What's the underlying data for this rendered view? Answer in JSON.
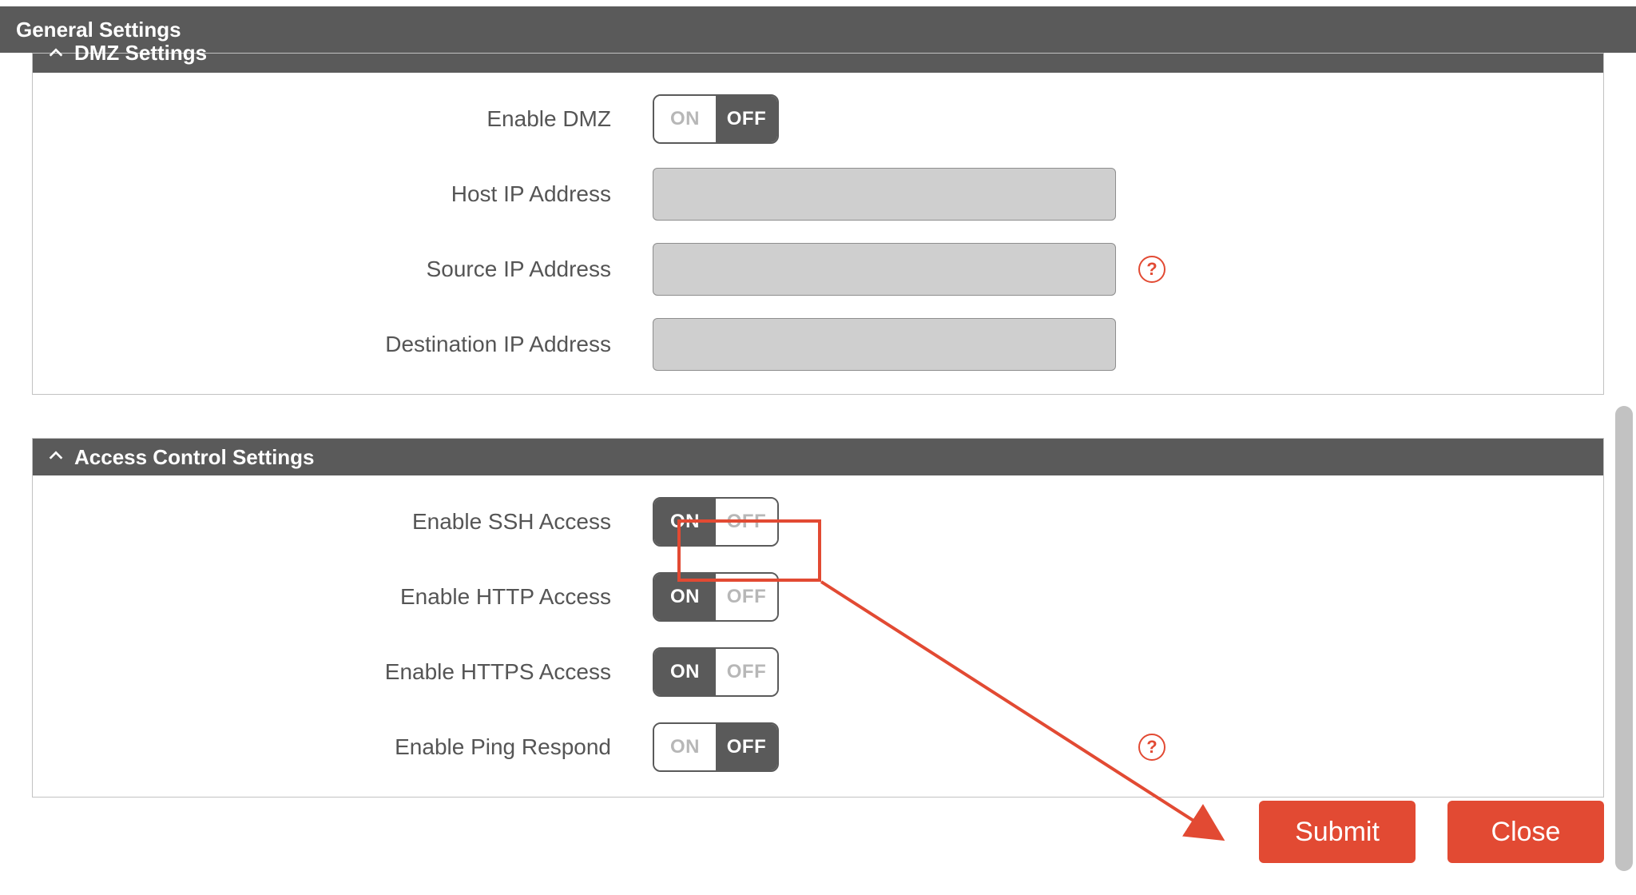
{
  "page_title": "General Settings",
  "toggle": {
    "on": "ON",
    "off": "OFF"
  },
  "help_glyph": "?",
  "sections": {
    "dmz": {
      "title": "DMZ Settings",
      "rows": {
        "enable": {
          "label": "Enable DMZ",
          "state": "off"
        },
        "host_ip": {
          "label": "Host IP Address",
          "value": ""
        },
        "src_ip": {
          "label": "Source IP Address",
          "value": "",
          "help": true
        },
        "dst_ip": {
          "label": "Destination IP Address",
          "value": ""
        }
      }
    },
    "acl": {
      "title": "Access Control Settings",
      "rows": {
        "ssh": {
          "label": "Enable SSH Access",
          "state": "on",
          "highlighted": true
        },
        "http": {
          "label": "Enable HTTP Access",
          "state": "on"
        },
        "https": {
          "label": "Enable HTTPS Access",
          "state": "on"
        },
        "ping": {
          "label": "Enable Ping Respond",
          "state": "off",
          "help": true
        }
      }
    }
  },
  "buttons": {
    "submit": "Submit",
    "close": "Close"
  },
  "annotation": {
    "highlight_target": "enable-ssh-toggle",
    "arrow_to": "submit-button"
  }
}
